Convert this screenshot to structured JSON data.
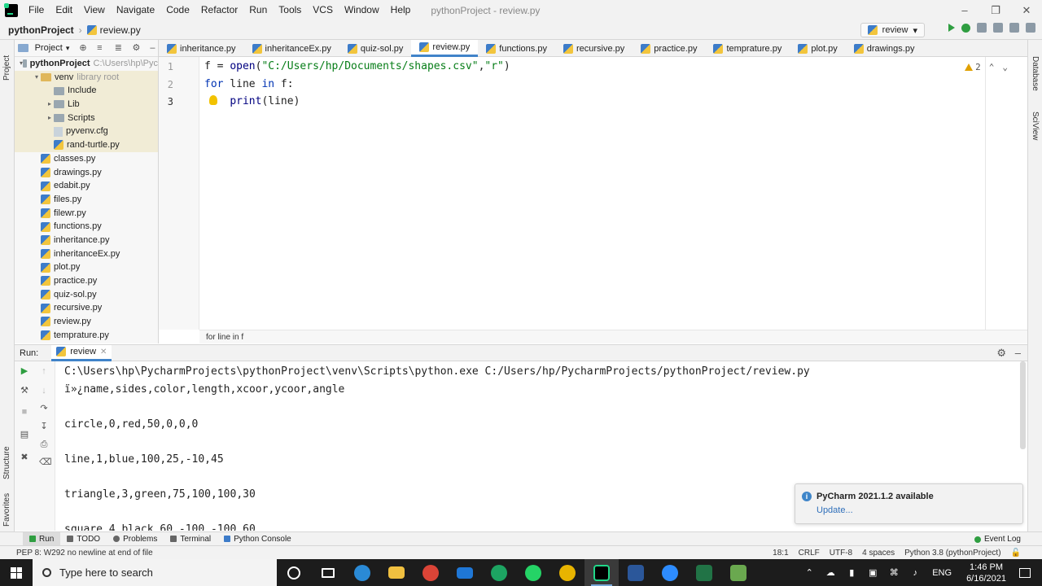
{
  "menubar": {
    "items": [
      "File",
      "Edit",
      "View",
      "Navigate",
      "Code",
      "Refactor",
      "Run",
      "Tools",
      "VCS",
      "Window",
      "Help"
    ],
    "window_title": "pythonProject - review.py"
  },
  "navbar": {
    "project": "pythonProject",
    "file": "review.py",
    "run_config": "review"
  },
  "stripes": {
    "left": [
      "Project",
      "Structure",
      "Favorites"
    ],
    "right": [
      "Database",
      "SciView"
    ]
  },
  "project_panel": {
    "title": "Project",
    "tree": [
      {
        "label": "pythonProject",
        "extra": "C:\\Users\\hp\\Pyc",
        "type": "folder",
        "indent": 0,
        "expanded": true,
        "bold": true
      },
      {
        "label": "venv",
        "extra": "library root",
        "type": "folder-orange",
        "indent": 1,
        "expanded": true,
        "excluded": true
      },
      {
        "label": "Include",
        "extra": "",
        "type": "folder",
        "indent": 2,
        "expanded": null,
        "excluded": true
      },
      {
        "label": "Lib",
        "extra": "",
        "type": "folder",
        "indent": 2,
        "expanded": false,
        "excluded": true
      },
      {
        "label": "Scripts",
        "extra": "",
        "type": "folder",
        "indent": 2,
        "expanded": false,
        "excluded": true
      },
      {
        "label": "pyvenv.cfg",
        "extra": "",
        "type": "file",
        "indent": 2,
        "expanded": null,
        "excluded": true
      },
      {
        "label": "rand-turtle.py",
        "extra": "",
        "type": "py",
        "indent": 2,
        "expanded": null,
        "excluded": true
      },
      {
        "label": "classes.py",
        "extra": "",
        "type": "py",
        "indent": 1,
        "expanded": null
      },
      {
        "label": "drawings.py",
        "extra": "",
        "type": "py",
        "indent": 1,
        "expanded": null
      },
      {
        "label": "edabit.py",
        "extra": "",
        "type": "py",
        "indent": 1,
        "expanded": null
      },
      {
        "label": "files.py",
        "extra": "",
        "type": "py",
        "indent": 1,
        "expanded": null
      },
      {
        "label": "filewr.py",
        "extra": "",
        "type": "py",
        "indent": 1,
        "expanded": null
      },
      {
        "label": "functions.py",
        "extra": "",
        "type": "py",
        "indent": 1,
        "expanded": null
      },
      {
        "label": "inheritance.py",
        "extra": "",
        "type": "py",
        "indent": 1,
        "expanded": null
      },
      {
        "label": "inheritanceEx.py",
        "extra": "",
        "type": "py",
        "indent": 1,
        "expanded": null
      },
      {
        "label": "plot.py",
        "extra": "",
        "type": "py",
        "indent": 1,
        "expanded": null
      },
      {
        "label": "practice.py",
        "extra": "",
        "type": "py",
        "indent": 1,
        "expanded": null
      },
      {
        "label": "quiz-sol.py",
        "extra": "",
        "type": "py",
        "indent": 1,
        "expanded": null
      },
      {
        "label": "recursive.py",
        "extra": "",
        "type": "py",
        "indent": 1,
        "expanded": null
      },
      {
        "label": "review.py",
        "extra": "",
        "type": "py",
        "indent": 1,
        "expanded": null
      },
      {
        "label": "temprature.py",
        "extra": "",
        "type": "py",
        "indent": 1,
        "expanded": null
      }
    ]
  },
  "editor": {
    "tabs": [
      {
        "label": "inheritance.py",
        "active": false
      },
      {
        "label": "inheritanceEx.py",
        "active": false
      },
      {
        "label": "quiz-sol.py",
        "active": false
      },
      {
        "label": "review.py",
        "active": true
      },
      {
        "label": "functions.py",
        "active": false
      },
      {
        "label": "recursive.py",
        "active": false
      },
      {
        "label": "practice.py",
        "active": false
      },
      {
        "label": "temprature.py",
        "active": false
      },
      {
        "label": "plot.py",
        "active": false
      },
      {
        "label": "drawings.py",
        "active": false
      }
    ],
    "line_numbers": [
      "1",
      "2",
      "3"
    ],
    "line1": {
      "a": "f = ",
      "fn": "open",
      "b": "(",
      "s1": "\"C:/Users/hp/Documents/shapes.csv\"",
      "c": ",",
      "s2": "\"r\"",
      "d": ")"
    },
    "line2": {
      "kw1": "for",
      "a": " line ",
      "kw2": "in",
      "b": " f:"
    },
    "line3": {
      "indent": "    ",
      "fn": "print",
      "a": "(line)"
    },
    "warning_count": "2",
    "breadcrumb": "for line in f"
  },
  "run_panel": {
    "label": "Run:",
    "tab": "review",
    "console_lines": [
      "C:\\Users\\hp\\PycharmProjects\\pythonProject\\venv\\Scripts\\python.exe C:/Users/hp/PycharmProjects/pythonProject/review.py",
      "ï»¿name,sides,color,length,xcoor,ycoor,angle",
      "",
      "circle,0,red,50,0,0,0",
      "",
      "line,1,blue,100,25,-10,45",
      "",
      "triangle,3,green,75,100,100,30",
      "",
      "square,4,black,60,-100,-100,60"
    ]
  },
  "notification": {
    "title": "PyCharm 2021.1.2 available",
    "link": "Update..."
  },
  "tool_windows": {
    "items": [
      "Run",
      "TODO",
      "Problems",
      "Terminal",
      "Python Console"
    ],
    "event_log": "Event Log"
  },
  "status_bar": {
    "message": "PEP 8: W292 no newline at end of file",
    "position": "18:1",
    "line_sep": "CRLF",
    "encoding": "UTF-8",
    "indent": "4 spaces",
    "interpreter": "Python 3.8 (pythonProject)"
  },
  "taskbar": {
    "search_placeholder": "Type here to search",
    "language": "ENG",
    "time": "1:46 PM",
    "date": "6/16/2021"
  }
}
